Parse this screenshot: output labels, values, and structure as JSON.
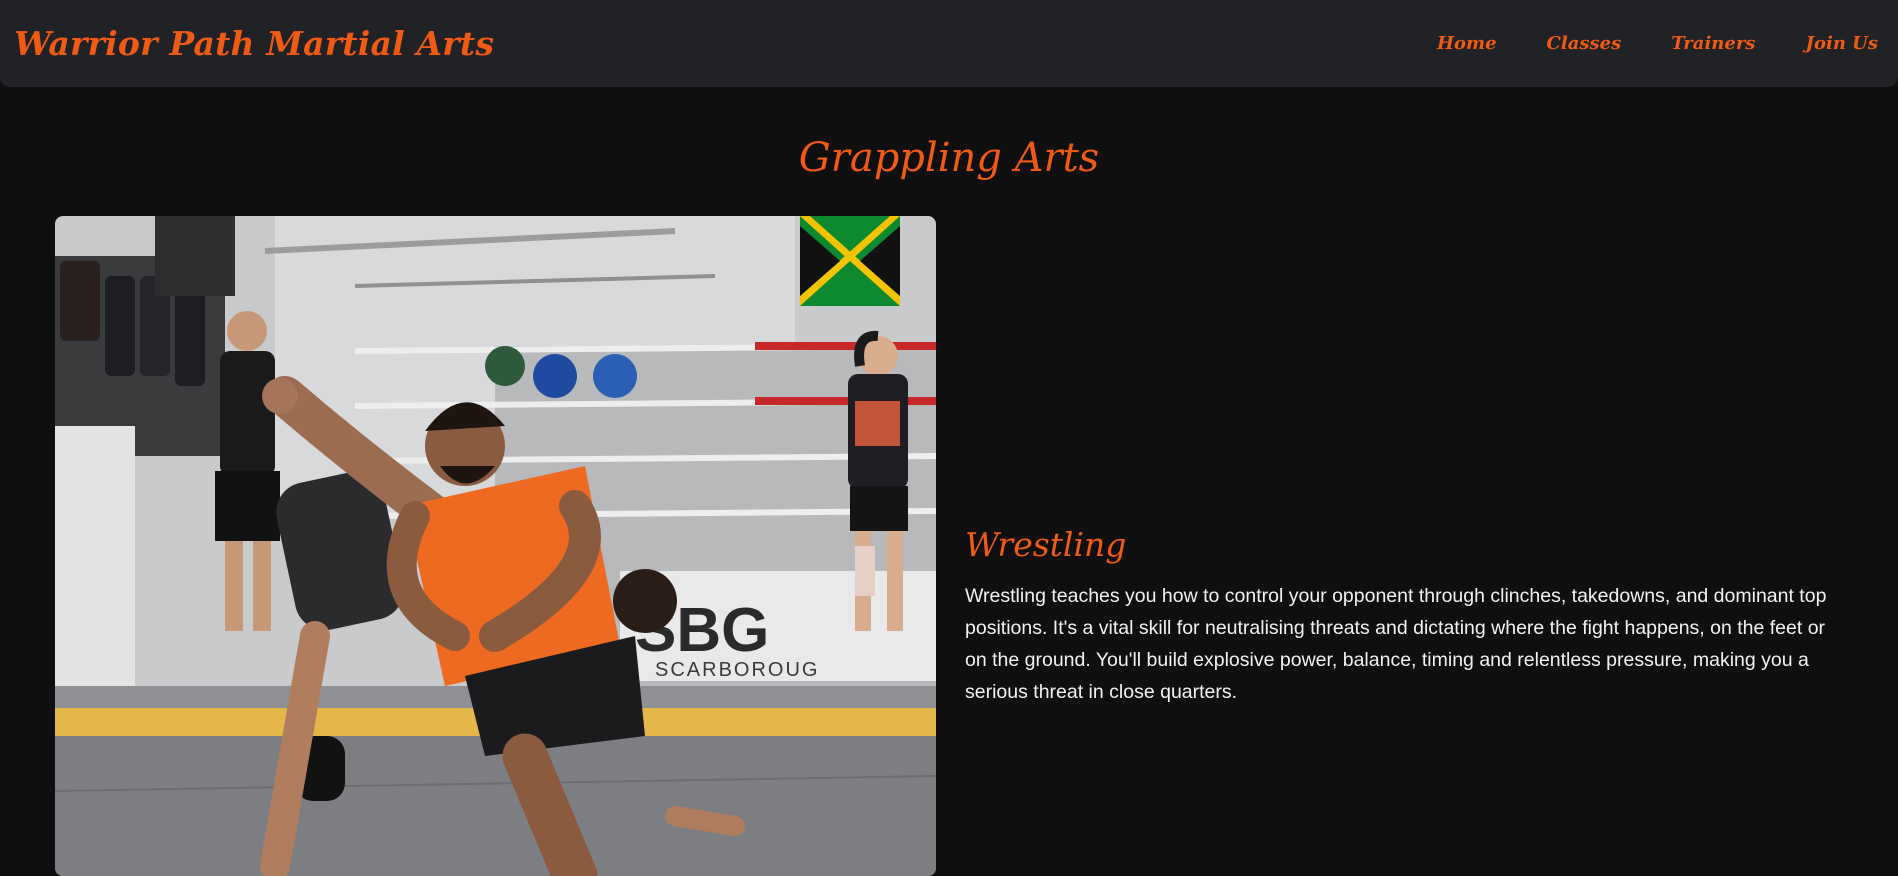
{
  "nav": {
    "brand": "Warrior Path Martial Arts",
    "links": [
      "Home",
      "Classes",
      "Trainers",
      "Join Us"
    ]
  },
  "section": {
    "title": "Grappling Arts"
  },
  "class": {
    "image_alt": "Wrestling training session",
    "title": "Wrestling",
    "description": "Wrestling teaches you how to control your opponent through clinches, takedowns, and dominant top positions. It's a vital skill for neutralising threats and dictating where the fight happens, on the feet or on the ground. You'll build explosive power, balance, timing and relentless pressure, making you a serious threat in close quarters.",
    "banner_text": "SBG",
    "banner_subtext": "SCARBOROUG"
  },
  "colors": {
    "accent": "#f05a12",
    "nav_bg": "#202226",
    "page_bg": "#0f0f0f",
    "text": "#f2f2f2"
  }
}
